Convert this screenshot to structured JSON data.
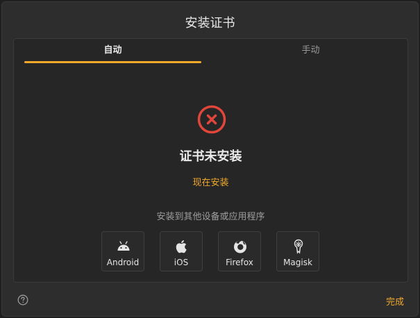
{
  "dialog": {
    "title": "安装证书"
  },
  "tabs": [
    {
      "label": "自动",
      "active": true
    },
    {
      "label": "手动",
      "active": false
    }
  ],
  "status": {
    "icon": "error-circle-icon",
    "title": "证书未安装",
    "install_link": "现在安装"
  },
  "other": {
    "label": "安装到其他设备或应用程序",
    "platforms": [
      {
        "label": "Android",
        "icon": "android-icon"
      },
      {
        "label": "iOS",
        "icon": "apple-icon"
      },
      {
        "label": "Firefox",
        "icon": "firefox-icon"
      },
      {
        "label": "Magisk",
        "icon": "magisk-icon"
      }
    ]
  },
  "footer": {
    "help_icon": "help-icon",
    "done_label": "完成"
  },
  "colors": {
    "accent": "#f0a92b",
    "error": "#e0463a",
    "background": "#2d2d2d"
  }
}
